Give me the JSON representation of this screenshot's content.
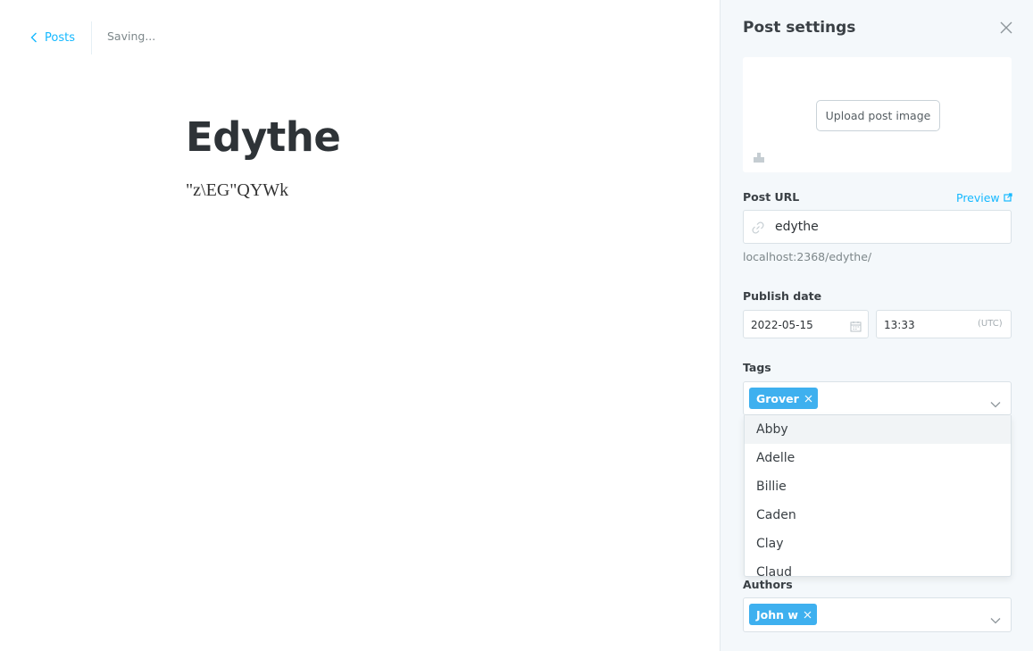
{
  "editor": {
    "back_label": "Posts",
    "save_status": "Saving...",
    "title": "Edythe",
    "body": "\"z\\EG\"QYWk"
  },
  "settings": {
    "title": "Post settings",
    "upload_label": "Upload post image",
    "post_url": {
      "label": "Post URL",
      "preview_label": "Preview",
      "value": "edythe",
      "hint": "localhost:2368/edythe/"
    },
    "publish_date": {
      "label": "Publish date",
      "date": "2022-05-15",
      "time": "13:33",
      "timezone": "(UTC)"
    },
    "tags": {
      "label": "Tags",
      "selected": [
        "Grover"
      ],
      "options": [
        "Abby",
        "Adelle",
        "Billie",
        "Caden",
        "Clay",
        "Claud"
      ]
    },
    "authors": {
      "label": "Authors",
      "selected": [
        "John w"
      ]
    }
  },
  "colors": {
    "accent": "#14b8ff",
    "token": "#3eb0ef",
    "panel_bg": "#f4f8fb"
  }
}
